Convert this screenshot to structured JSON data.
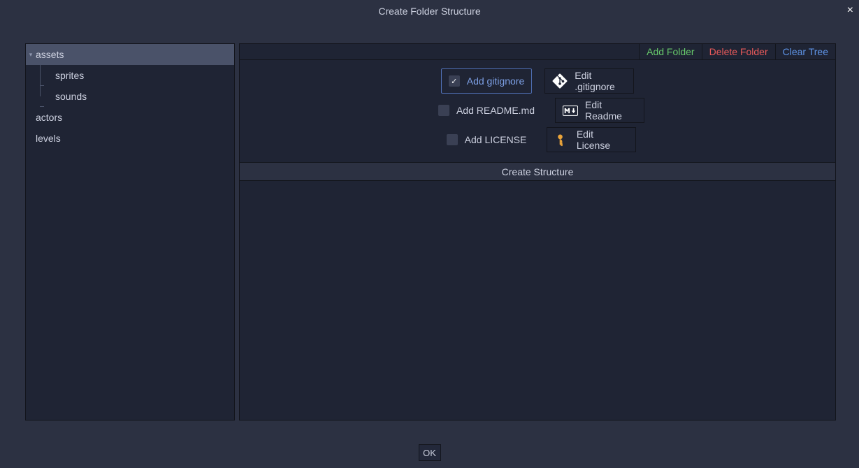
{
  "title": "Create Folder Structure",
  "close_glyph": "×",
  "tree": {
    "items": [
      {
        "label": "assets"
      },
      {
        "label": "sprites"
      },
      {
        "label": "sounds"
      },
      {
        "label": "actors"
      },
      {
        "label": "levels"
      }
    ]
  },
  "toolbar": {
    "add_folder": "Add Folder",
    "delete_folder": "Delete Folder",
    "clear_tree": "Clear Tree"
  },
  "options": {
    "gitignore": {
      "checkbox_label": "Add gitignore",
      "edit_label": "Edit .gitignore",
      "checked": true
    },
    "readme": {
      "checkbox_label": "Add README.md",
      "edit_label": "Edit Readme",
      "checked": false
    },
    "license": {
      "checkbox_label": "Add LICENSE",
      "edit_label": "Edit License",
      "checked": false
    }
  },
  "create_button": "Create Structure",
  "ok_button": "OK"
}
